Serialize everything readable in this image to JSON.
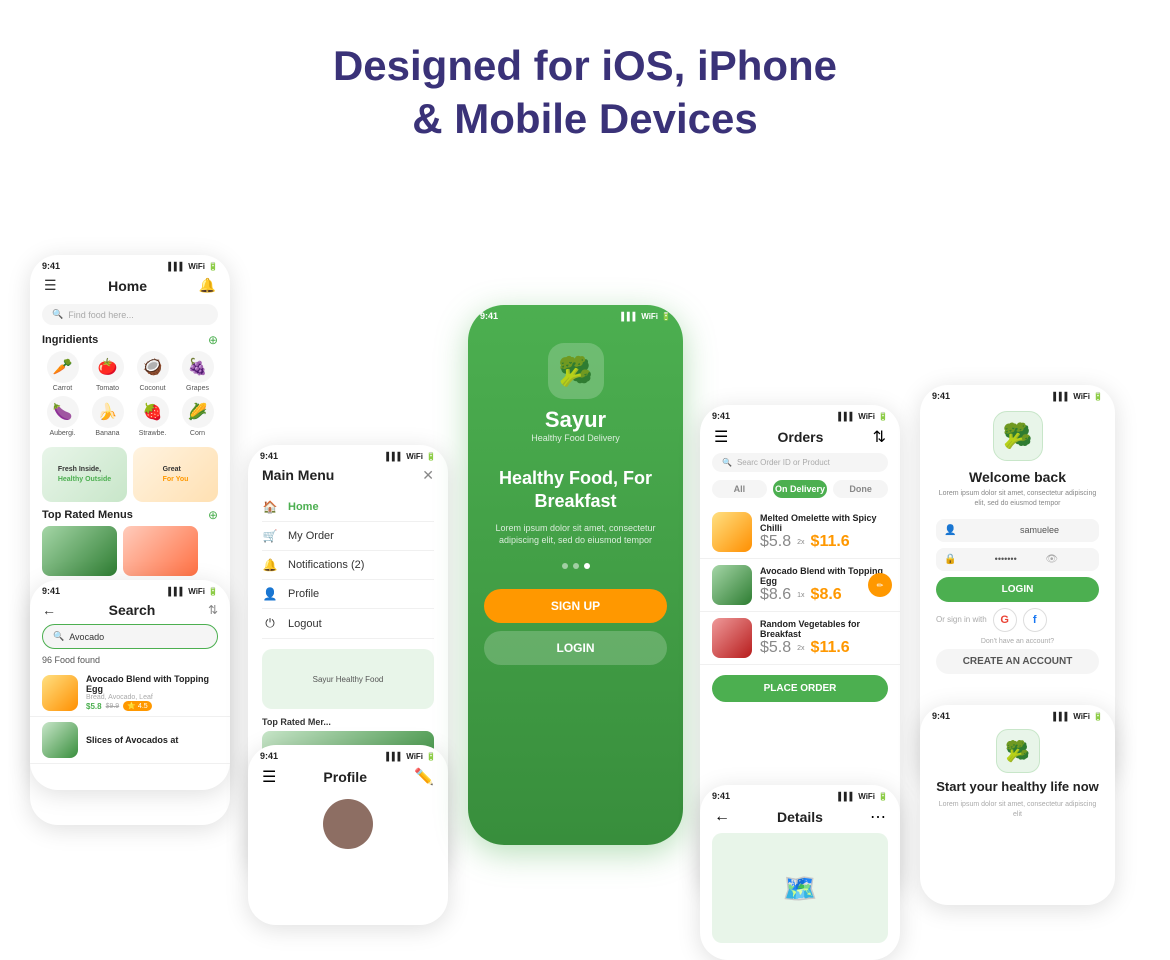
{
  "header": {
    "title_line1": "Designed for iOS, iPhone",
    "title_line2": "& Mobile Devices"
  },
  "phones": {
    "home": {
      "status_time": "9:41",
      "title": "Home",
      "search_placeholder": "Find food here...",
      "ingredients_label": "Ingridients",
      "ingredients": [
        {
          "name": "Carrot",
          "emoji": "🥕"
        },
        {
          "name": "Tomato",
          "emoji": "🍅"
        },
        {
          "name": "Coconut",
          "emoji": "🥥"
        },
        {
          "name": "Grapes",
          "emoji": "🍇"
        },
        {
          "name": "Aubergi.",
          "emoji": "🍆"
        },
        {
          "name": "Banana",
          "emoji": "🍌"
        },
        {
          "name": "Strawbe.",
          "emoji": "🍓"
        },
        {
          "name": "Corn",
          "emoji": "🌽"
        }
      ],
      "banner1_text": "Fresh Inside, Healthy Outside",
      "banner2_text": "Great For You",
      "top_rated_label": "Top Rated Menus"
    },
    "search": {
      "status_time": "9:41",
      "title": "Search",
      "search_value": "Avocado",
      "found_count": "96 Food found",
      "item1_name": "Avocado Blend with Topping Egg",
      "item1_sub": "Bread, Avocado, Leaf",
      "item1_price": "$5.8",
      "item1_old": "$9.9",
      "item1_rating": "4.5",
      "item2_name": "Slices of Avocados at",
      "item2_sub": ""
    },
    "menu": {
      "status_time": "9:41",
      "title": "Main Menu",
      "items": [
        {
          "label": "Home",
          "active": true,
          "icon": "🏠"
        },
        {
          "label": "My Order",
          "active": false,
          "icon": "🛒"
        },
        {
          "label": "Notifications (2)",
          "active": false,
          "icon": "🔔"
        },
        {
          "label": "Profile",
          "active": false,
          "icon": "👤"
        },
        {
          "label": "Logout",
          "active": false,
          "icon": "⏻"
        }
      ],
      "thumbnail_label": "Sayur Healthy Food",
      "top_rated_label": "Top Rated Mer..."
    },
    "profile": {
      "status_time": "9:41",
      "title": "Profile"
    },
    "main": {
      "status_time": "9:41",
      "app_name": "Sayur",
      "app_tagline": "Healthy Food Delivery",
      "headline": "Healthy Food, For Breakfast",
      "description": "Lorem ipsum dolor sit amet, consectetur adipiscing elit, sed do eiusmod tempor",
      "btn_signup": "SIGN UP",
      "btn_login": "LOGIN"
    },
    "orders": {
      "status_time": "9:41",
      "title": "Orders",
      "search_placeholder": "Searc Order ID or Product",
      "tabs": [
        "All",
        "On Delivery",
        "Done"
      ],
      "active_tab": 1,
      "items": [
        {
          "name": "Melted Omelette with Spicy Chilli",
          "price": "$5.8",
          "qty": "2x",
          "total": "$11.6",
          "has_edit": false
        },
        {
          "name": "Avocado Blend with Topping Egg",
          "price": "$8.6",
          "qty": "1x",
          "total": "$8.6",
          "has_edit": true
        },
        {
          "name": "Random Vegetables for Breakfast",
          "price": "$5.8",
          "qty": "2x",
          "total": "$11.6",
          "has_edit": false
        }
      ],
      "place_order_btn": "PLACE ORDER"
    },
    "details": {
      "status_time": "9:41",
      "title": "Details"
    },
    "login": {
      "status_time": "9:41",
      "title": "Welcome back",
      "description": "Lorem ipsum dolor sit amet, consectetur adipiscing elit, sed do eiusmod tempor",
      "username": "samuelee",
      "password": "•••••••",
      "btn_login": "LOGIN",
      "or_sign_in": "Or sign in with",
      "dont_have": "Don't have an account?",
      "btn_create": "CREATE AN ACCOUNT"
    },
    "healthy": {
      "status_time": "9:41",
      "title": "Start your healthy life now",
      "description": "Lorem ipsum dolor sit amet, consectetur adipiscing elit"
    }
  }
}
